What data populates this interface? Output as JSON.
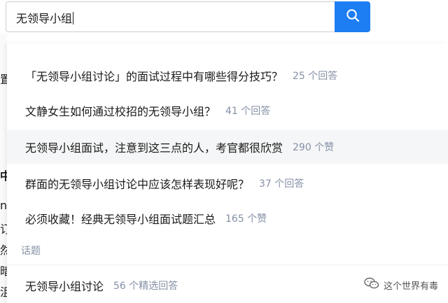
{
  "search": {
    "value": "无领导小组",
    "button_icon": "search-icon"
  },
  "background_fragments": [
    "置",
    "中",
    "n",
    "订",
    "然",
    "暗",
    "沮"
  ],
  "suggestions": [
    {
      "title": "「无领导小组讨论」的面试过程中有哪些得分技巧？",
      "meta": "25 个回答"
    },
    {
      "title": "文静女生如何通过校招的无领导小组？",
      "meta": "41 个回答"
    },
    {
      "title": "无领导小组面试，注意到这三点的人，考官都很欣赏",
      "meta": "290 个赞"
    },
    {
      "title": "群面的无领导小组讨论中应该怎样表现好呢？",
      "meta": "37 个回答"
    },
    {
      "title": "必须收藏！经典无领导小组面试题汇总",
      "meta": "165 个赞"
    }
  ],
  "topics_section": {
    "label": "话题",
    "items": [
      {
        "title": "无领导小组讨论",
        "meta": "56 个精选回答"
      }
    ]
  },
  "watermark": {
    "icon": "wechat-icon",
    "text": "这个世界有毒"
  },
  "colors": {
    "accent": "#1d7df2",
    "meta": "#8590a6",
    "highlight_row": "#f5f6f7"
  }
}
